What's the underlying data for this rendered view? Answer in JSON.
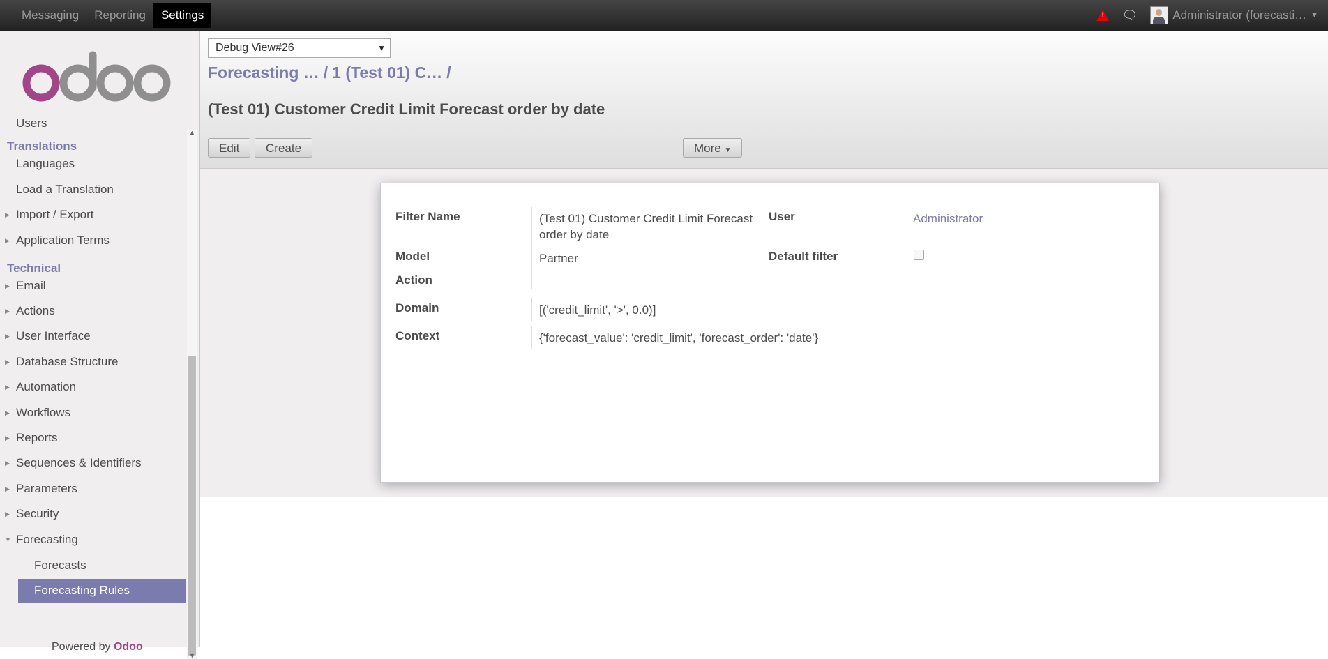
{
  "topbar": {
    "menu": [
      "Messaging",
      "Reporting",
      "Settings"
    ],
    "user": "Administrator (forecasti…"
  },
  "logo": "odoo",
  "sidebar": {
    "cut_item": "Users",
    "translations_header": "Translations",
    "languages": "Languages",
    "load_translation": "Load a Translation",
    "import_export": "Import / Export",
    "application_terms": "Application Terms",
    "technical_header": "Technical",
    "items": [
      "Email",
      "Actions",
      "User Interface",
      "Database Structure",
      "Automation",
      "Workflows",
      "Reports",
      "Sequences & Identifiers",
      "Parameters",
      "Security",
      "Forecasting"
    ],
    "forecasts": "Forecasts",
    "forecasting_rules": "Forecasting Rules",
    "powered_prefix": "Powered by",
    "powered_brand": "Odoo"
  },
  "control": {
    "debug_select": "Debug View#26",
    "breadcrumb": [
      "Forecasting …",
      "1 (Test 01) C…"
    ],
    "title": "(Test 01) Customer Credit Limit Forecast order by date",
    "edit": "Edit",
    "create": "Create",
    "more": "More"
  },
  "form": {
    "filter_name_label": "Filter Name",
    "filter_name": "(Test 01) Customer Credit Limit Forecast order by date",
    "user_label": "User",
    "user": "Administrator",
    "model_label": "Model",
    "model": "Partner",
    "default_filter_label": "Default filter",
    "default_filter": false,
    "action_label": "Action",
    "domain_label": "Domain",
    "domain": "[('credit_limit', '>', 0.0)]",
    "context_label": "Context",
    "context": "{'forecast_value': 'credit_limit', 'forecast_order': 'date'}"
  }
}
